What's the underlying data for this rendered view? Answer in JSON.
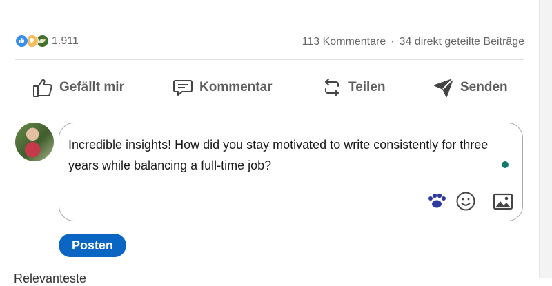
{
  "reactions": {
    "count": "1.911",
    "icons": [
      "like-icon",
      "insightful-icon",
      "support-icon"
    ],
    "colors": {
      "like": "#378fe9",
      "insightful": "#f5bb5c",
      "support": "#44712e"
    }
  },
  "stats": {
    "comments": "113 Kommentare",
    "separator": "·",
    "reposts": "34 direkt geteilte Beiträge"
  },
  "actions": {
    "like": "Gefällt mir",
    "comment": "Kommentar",
    "repost": "Teilen",
    "send": "Senden"
  },
  "comment_box": {
    "text": "Incredible insights! How did you stay motivated to write consistently for three years while balancing a full-time job?",
    "status_dot_color": "#127a6a",
    "icons": [
      "group-mention-icon",
      "emoji-icon",
      "image-icon"
    ]
  },
  "post_button": {
    "label": "Posten",
    "color": "#0a66c2"
  },
  "below": {
    "partial_text": "Relevanteste"
  }
}
